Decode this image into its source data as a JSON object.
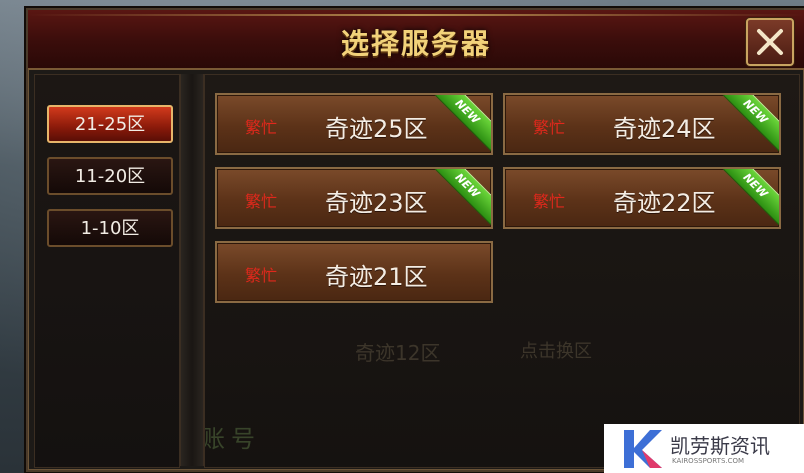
{
  "dialog": {
    "title": "选择服务器",
    "close_icon": "close-x-icon"
  },
  "sidebar": {
    "tabs": [
      {
        "label": "21-25区",
        "active": true
      },
      {
        "label": "11-20区",
        "active": false
      },
      {
        "label": "1-10区",
        "active": false
      }
    ]
  },
  "servers": [
    {
      "status": "繁忙",
      "name": "奇迹25区",
      "badge": "NEW"
    },
    {
      "status": "繁忙",
      "name": "奇迹24区",
      "badge": "NEW"
    },
    {
      "status": "繁忙",
      "name": "奇迹23区",
      "badge": "NEW"
    },
    {
      "status": "繁忙",
      "name": "奇迹22区",
      "badge": "NEW"
    },
    {
      "status": "繁忙",
      "name": "奇迹21区",
      "badge": ""
    }
  ],
  "background": {
    "server_text": "奇迹12区",
    "hint_text": "点击换区",
    "switch_button": "切换账号"
  },
  "watermark": {
    "name": "凯劳斯资讯",
    "sub": "KAIROSSPORTS.COM"
  },
  "colors": {
    "title_gold": "#f2d27a",
    "status_red": "#e0281c",
    "active_tab": "#d23a1c",
    "new_badge": "#4fb82a"
  }
}
